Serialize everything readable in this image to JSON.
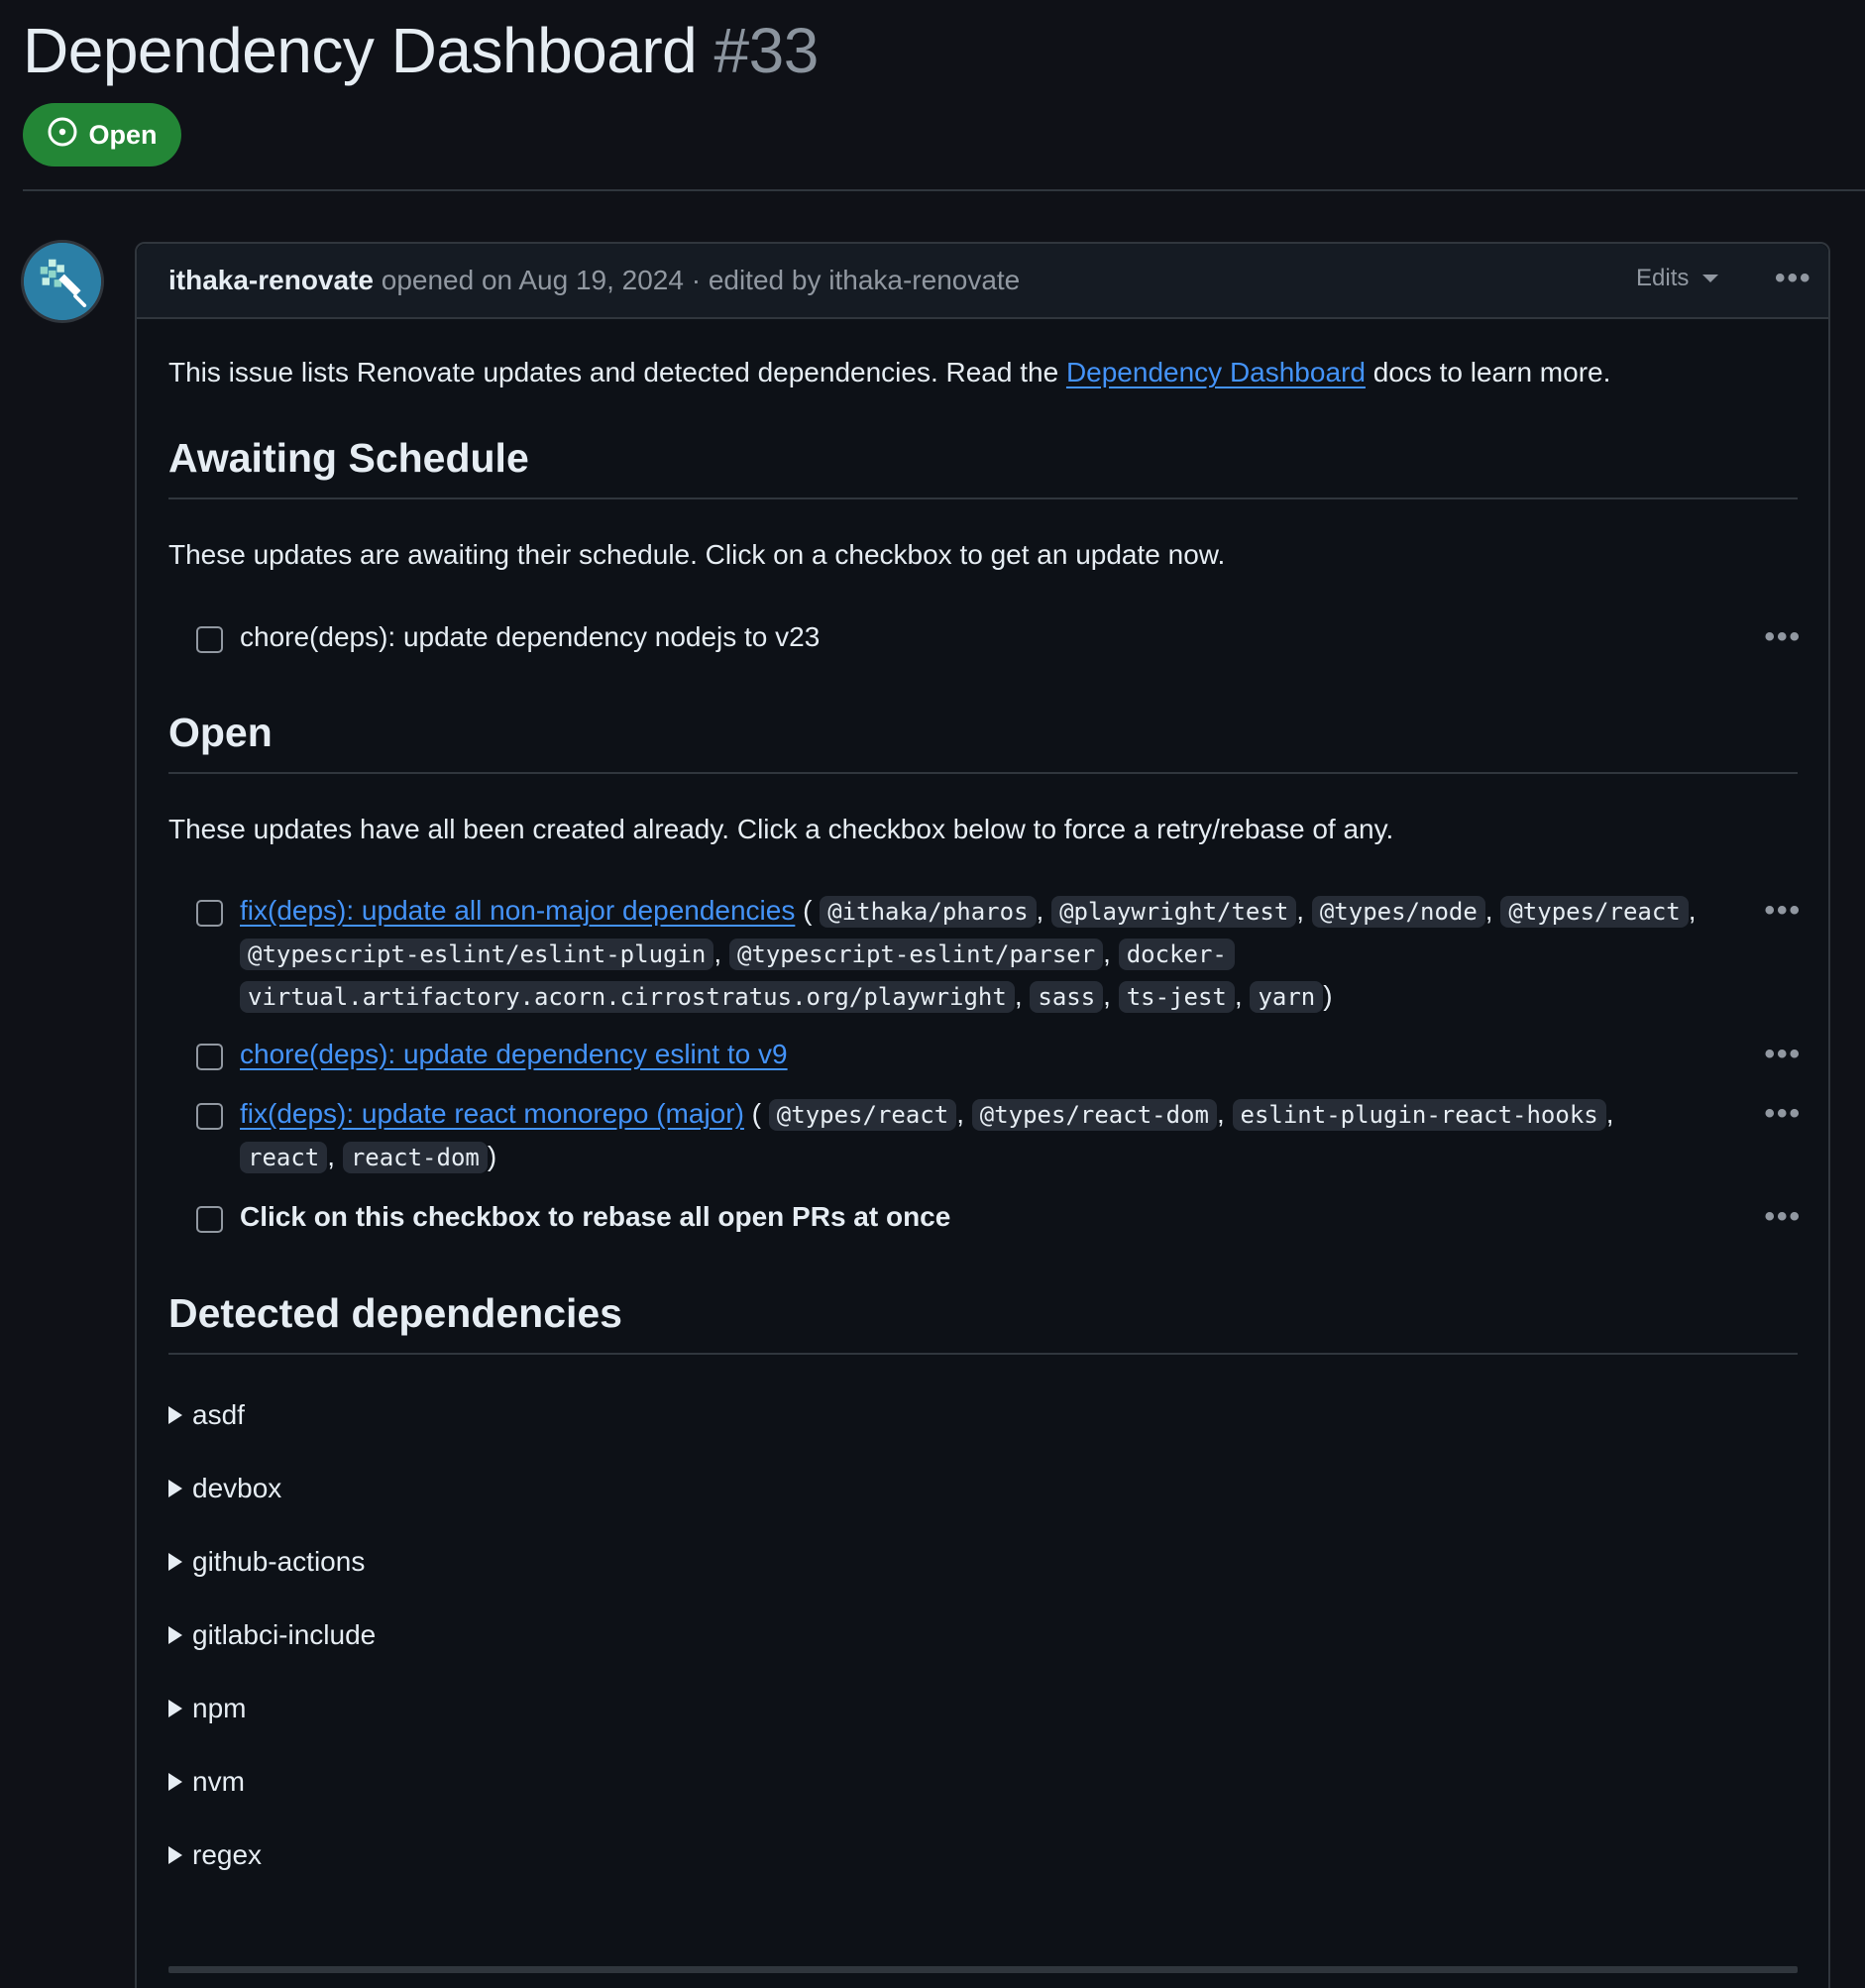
{
  "issue": {
    "title": "Dependency Dashboard",
    "number": "#33",
    "state": "Open",
    "state_color": "#238636"
  },
  "comment": {
    "author": "ithaka-renovate",
    "opened_text": "opened on Aug 19, 2024 · edited by",
    "editor": "ithaka-renovate",
    "edits_label": "Edits",
    "more_icon": "kebab-horizontal-icon"
  },
  "body": {
    "intro_before": "This issue lists Renovate updates and detected dependencies. Read the",
    "intro_link": "Dependency Dashboard",
    "intro_after": "docs to learn more.",
    "awaiting": {
      "heading": "Awaiting Schedule",
      "desc": "These updates are awaiting their schedule. Click on a checkbox to get an update now.",
      "items": [
        "chore(deps): update dependency nodejs to v23"
      ]
    },
    "open": {
      "heading": "Open",
      "desc": "These updates have all been created already. Click a checkbox below to force a retry/rebase of any.",
      "item1": {
        "link": "fix(deps): update all non-major dependencies",
        "packages": [
          "@ithaka/pharos",
          "@playwright/test",
          "@types/node",
          "@types/react",
          "@typescript-eslint/eslint-plugin",
          "@typescript-eslint/parser",
          "docker-",
          "virtual.artifactory.acorn.cirrostratus.org/playwright",
          "sass",
          "ts-jest",
          "yarn"
        ]
      },
      "item2": {
        "link": "chore(deps): update dependency eslint to v9"
      },
      "item3": {
        "link": "fix(deps): update react monorepo (major)",
        "packages": [
          "@types/react",
          "@types/react-dom",
          "eslint-plugin-react-hooks",
          "react",
          "react-dom"
        ]
      },
      "item4": {
        "text": "Click on this checkbox to rebase all open PRs at once"
      }
    },
    "detected": {
      "heading": "Detected dependencies",
      "managers": [
        "asdf",
        "devbox",
        "github-actions",
        "gitlabci-include",
        "npm",
        "nvm",
        "regex"
      ]
    }
  },
  "colors": {
    "background": "#0f1117",
    "link": "#4493f8",
    "muted": "#9198a1",
    "border": "#30363d"
  }
}
